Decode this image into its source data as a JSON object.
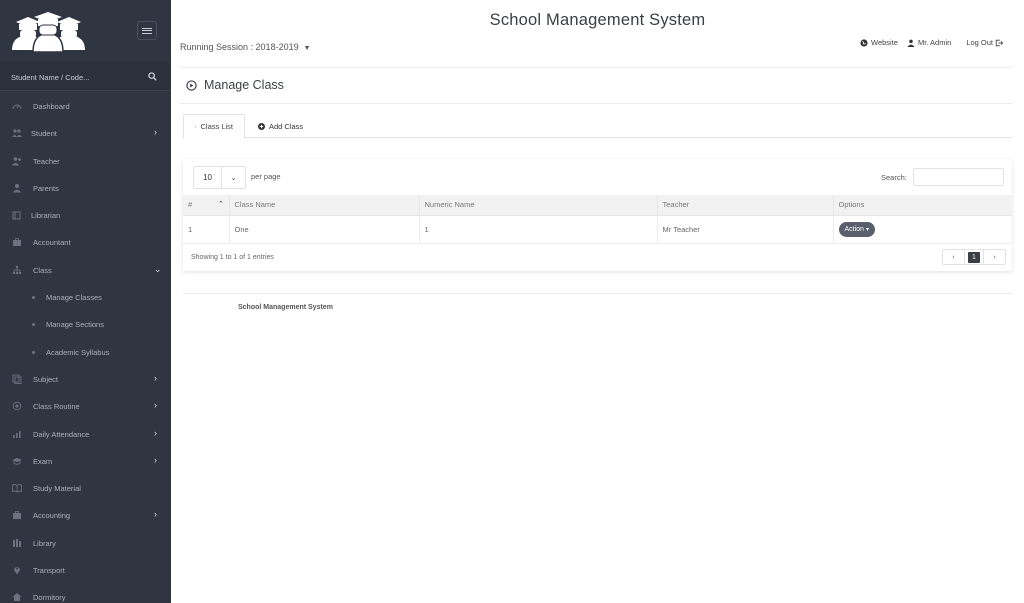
{
  "sidebar": {
    "search_placeholder": "Student Name / Code...",
    "items": [
      {
        "label": "Dashboard",
        "icon": "gauge-icon",
        "has_caret": false
      },
      {
        "label": "Student",
        "icon": "group-icon",
        "has_caret": true,
        "caret": "›"
      },
      {
        "label": "Teacher",
        "icon": "users-icon",
        "has_caret": false
      },
      {
        "label": "Parents",
        "icon": "user-icon",
        "has_caret": false
      },
      {
        "label": "Librarian",
        "icon": "book-icon",
        "has_caret": false
      },
      {
        "label": "Accountant",
        "icon": "briefcase-icon",
        "has_caret": false
      },
      {
        "label": "Class",
        "icon": "flow-tree-icon",
        "has_caret": true,
        "caret": "⌄"
      }
    ],
    "sub_items": [
      {
        "label": "Manage Classes"
      },
      {
        "label": "Manage Sections"
      },
      {
        "label": "Academic Syllabus"
      }
    ],
    "items_after": [
      {
        "label": "Subject",
        "icon": "docs-icon",
        "caret": "›"
      },
      {
        "label": "Class Routine",
        "icon": "target-icon",
        "caret": "›"
      },
      {
        "label": "Daily Attendance",
        "icon": "chart-bar-icon",
        "caret": "›"
      },
      {
        "label": "Exam",
        "icon": "graduation-cap-icon",
        "caret": "›"
      },
      {
        "label": "Study Material",
        "icon": "book-open-icon",
        "caret": ""
      },
      {
        "label": "Accounting",
        "icon": "suitcase-icon",
        "caret": "›"
      },
      {
        "label": "Library",
        "icon": "library-icon",
        "caret": ""
      },
      {
        "label": "Transport",
        "icon": "location-icon",
        "caret": ""
      },
      {
        "label": "Dormitory",
        "icon": "home-icon",
        "caret": ""
      }
    ]
  },
  "header": {
    "title": "School Management System",
    "session_label": "Running Session : 2018-2019",
    "session_arrow": "▼",
    "website": "Website",
    "user": "Mr. Admin",
    "logout": "Log Out"
  },
  "page": {
    "title": "Manage Class"
  },
  "tabs": [
    {
      "label": "Class List"
    },
    {
      "label": "Add Class"
    }
  ],
  "table": {
    "page_length": "10",
    "per_page_label": "per page",
    "search_label": "Search:",
    "columns": [
      "#",
      "Class Name",
      "Numeric Name",
      "Teacher",
      "Options"
    ],
    "rows": [
      {
        "id": "1",
        "class_name": "One",
        "numeric_name": "1",
        "teacher": "Mr Teacher",
        "action": "Action"
      }
    ],
    "showing": "Showing 1 to 1 of 1 entries",
    "pagination": {
      "prev": "‹",
      "current": "1",
      "next": "›"
    }
  },
  "footer": {
    "text": "School Management System"
  },
  "colors": {
    "sidebar_bg": "#303641",
    "accent_dark": "#3b3f45",
    "action_btn": "#5a5f6d"
  }
}
